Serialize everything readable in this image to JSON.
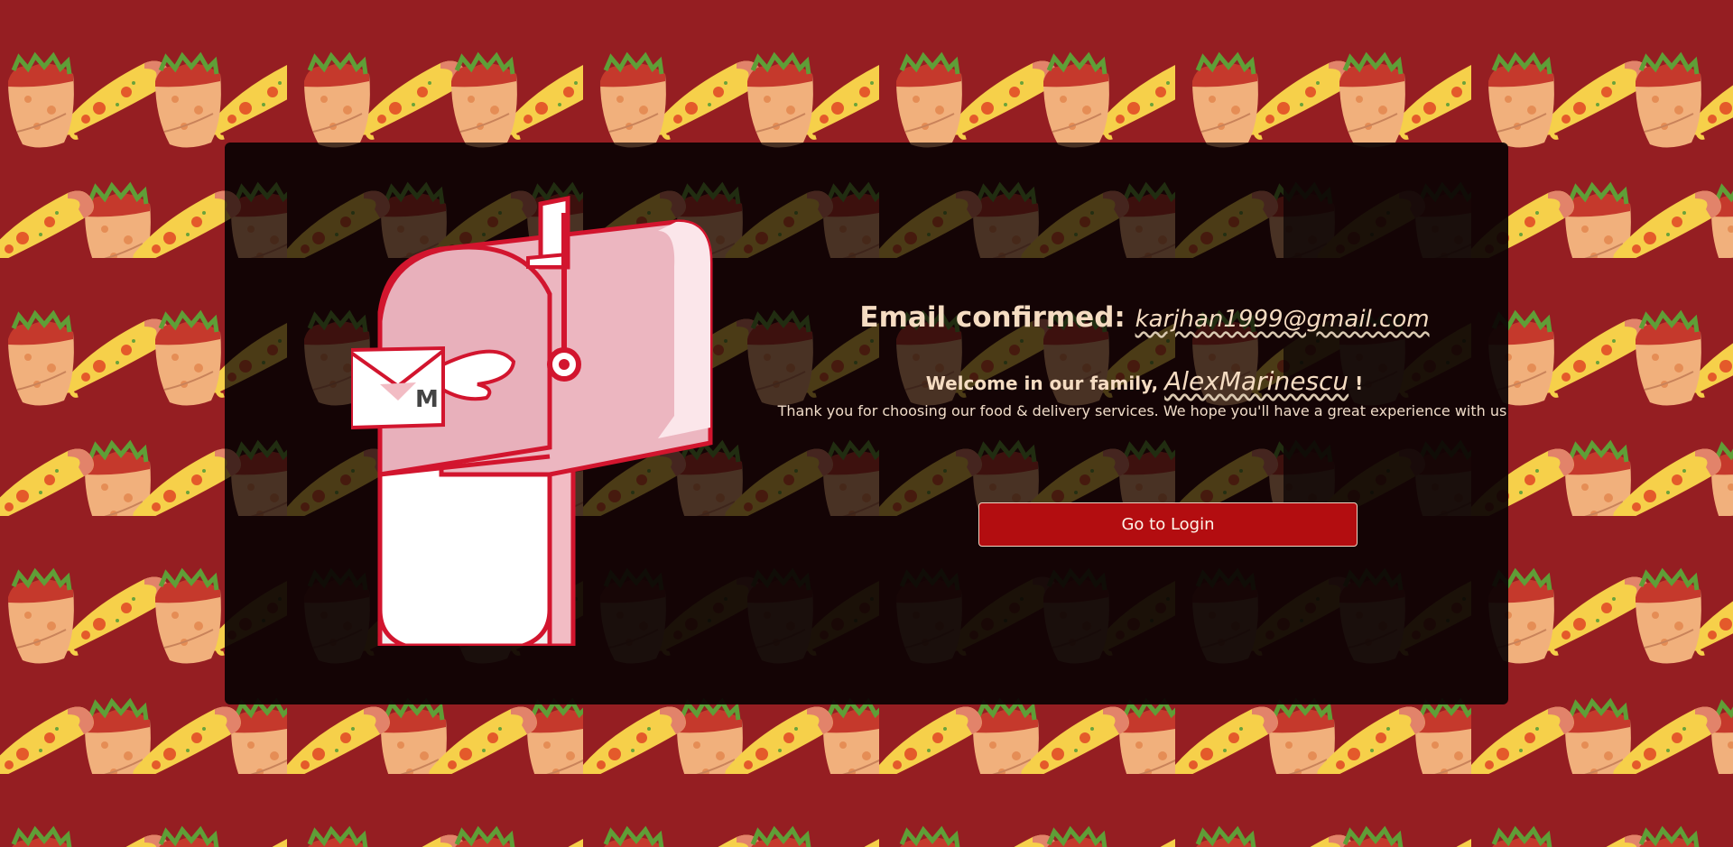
{
  "page": {
    "background_color": "#951e22",
    "pattern_icons": [
      "pizza-slice-icon",
      "burrito-icon"
    ]
  },
  "confirmation": {
    "title_prefix": "Email confirmed:",
    "email": "karjhan1999@gmail.com",
    "welcome_prefix": "Welcome in our family,",
    "username": "AlexMarinescu",
    "welcome_suffix": "!",
    "message": "Thank you for choosing our food & delivery services. We hope you'll have a great experience with us.",
    "illustration_icon": "mailbox-icon",
    "envelope_letter": "M"
  },
  "actions": {
    "login_label": "Go to Login",
    "button_color": "#b30d10"
  }
}
